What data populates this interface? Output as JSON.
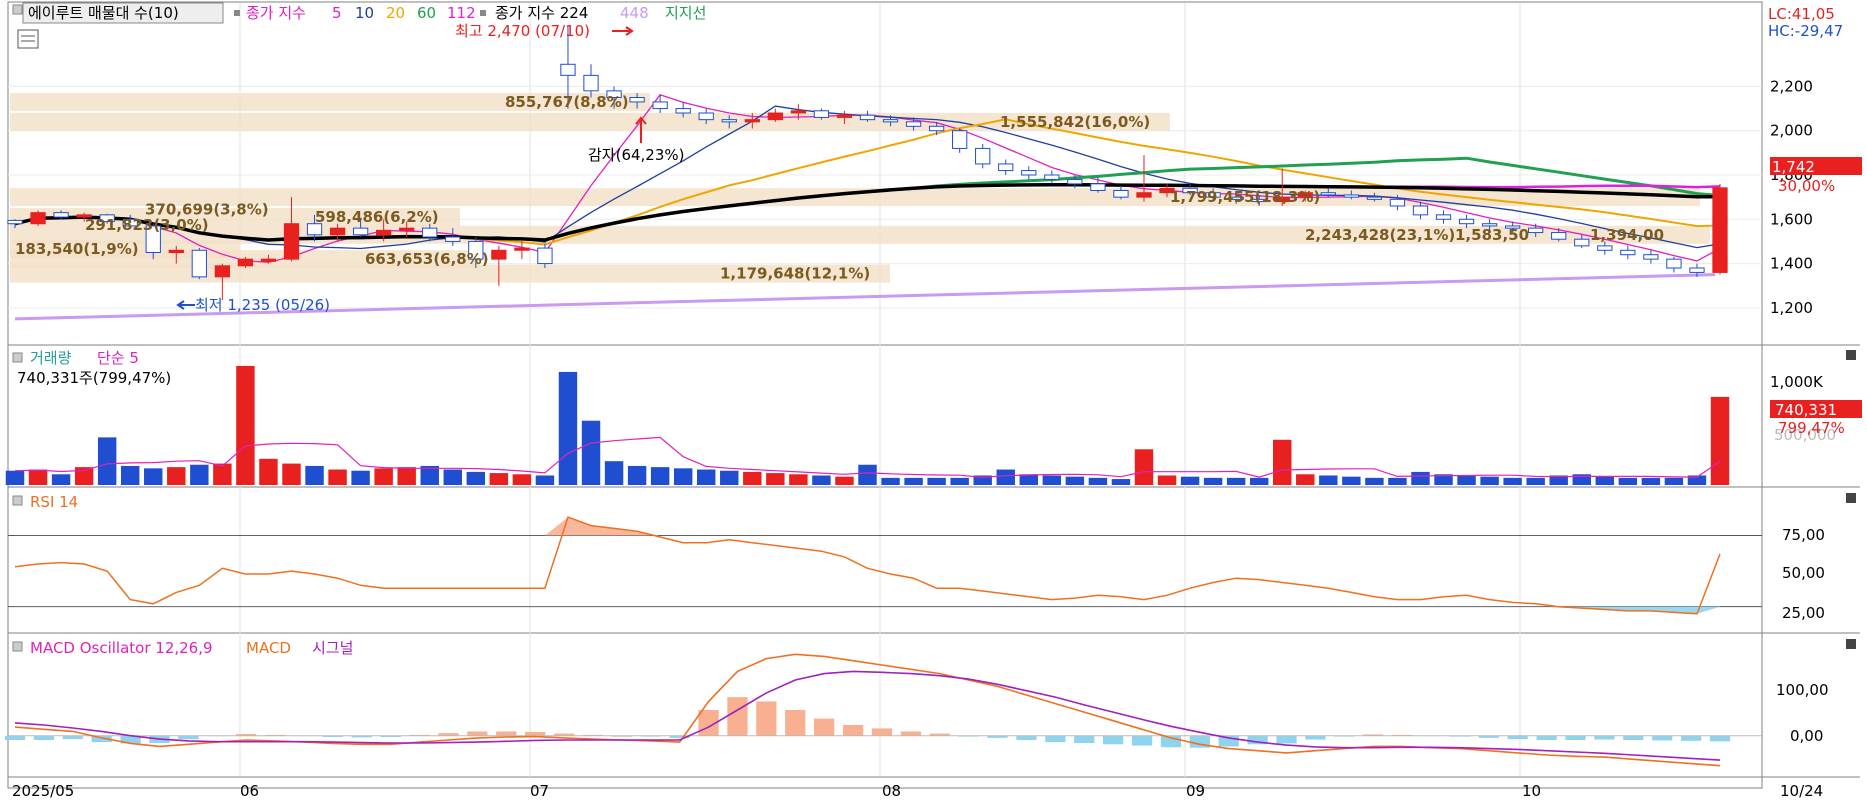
{
  "colors": {
    "up": "#e8201f",
    "down": "#1f4fd0",
    "ma5": "#e020c0",
    "ma10": "#1f3fa0",
    "ma20": "#f0a500",
    "ma60": "#20a050",
    "ma112": "#e020e0",
    "ma224": "#000000",
    "ma448": "#c89af0",
    "vol": "#20a0a0",
    "rsi": "#f07020",
    "macd": "#f07020",
    "signal": "#a020c0",
    "osc_pos": "#f8b090",
    "osc_neg": "#8fd4ef",
    "band": "#f3e0c7"
  },
  "price_panel": {
    "legend": {
      "main": "에이루트 매물대 수(10)",
      "ma_label": "종가 지수",
      "ma5": "5",
      "ma10": "10",
      "ma20": "20",
      "ma60": "60",
      "ma112": "112",
      "ma224_label": "종가 지수 224",
      "ma448": "448",
      "support": "지지선"
    },
    "lc": "LC:41,05",
    "hc": "HC:-29,47",
    "y_ticks": [
      "2,200",
      "2,000",
      "1,800",
      "1,600",
      "1,400",
      "1,200"
    ],
    "last_price": "1,742",
    "last_pct": "30,00%",
    "high_note": "최고 2,470 (07/10)",
    "low_note": "최저 1,235 (05/26)",
    "reduction_note": "감자(64,23%)",
    "bands": [
      "183,540(1,9%)",
      "291,823(3,0%)",
      "370,699(3,8%)",
      "598,486(6,2%)",
      "663,653(6,8%)",
      "1,179,648(12,1%)",
      "2,243,428(23,1%)",
      "1,583,50",
      "1,799,455(18,3%)",
      "855,767(8,8%)",
      "1,555,842(16,0%)",
      "1,394,00"
    ]
  },
  "volume_panel": {
    "title": "거래량",
    "ma_label": "단순 5",
    "summary": "740,331주(799,47%)",
    "y_tick": "1,000K",
    "y_tick2": "500,000",
    "last": "740,331",
    "last_pct": "799,47%"
  },
  "rsi_panel": {
    "title": "RSI 14",
    "y_ticks": [
      "75,00",
      "50,00",
      "25,00"
    ]
  },
  "macd_panel": {
    "title": "MACD Oscillator 12,26,9",
    "macd_label": "MACD",
    "signal_label": "시그널",
    "y_ticks": [
      "100,00",
      "0,00"
    ]
  },
  "x_axis": {
    "labels": [
      "2025/05",
      "06",
      "07",
      "08",
      "09",
      "10"
    ],
    "last": "10/24"
  },
  "chart_data": {
    "type": "line",
    "title": "에이루트 매물대 수(10)",
    "price_ylim": [
      1100,
      2500
    ],
    "candles": [
      [
        1595,
        1600,
        1560,
        1580
      ],
      [
        1580,
        1640,
        1570,
        1630
      ],
      [
        1630,
        1640,
        1600,
        1610
      ],
      [
        1610,
        1630,
        1590,
        1620
      ],
      [
        1620,
        1625,
        1580,
        1590
      ],
      [
        1600,
        1620,
        1560,
        1570
      ],
      [
        1570,
        1580,
        1420,
        1450
      ],
      [
        1450,
        1480,
        1400,
        1460
      ],
      [
        1460,
        1470,
        1330,
        1340
      ],
      [
        1340,
        1400,
        1235,
        1390
      ],
      [
        1390,
        1430,
        1380,
        1420
      ],
      [
        1410,
        1440,
        1400,
        1420
      ],
      [
        1420,
        1700,
        1410,
        1580
      ],
      [
        1580,
        1620,
        1500,
        1530
      ],
      [
        1530,
        1580,
        1500,
        1560
      ],
      [
        1560,
        1600,
        1520,
        1530
      ],
      [
        1530,
        1600,
        1500,
        1550
      ],
      [
        1550,
        1590,
        1520,
        1560
      ],
      [
        1560,
        1580,
        1500,
        1520
      ],
      [
        1520,
        1560,
        1480,
        1500
      ],
      [
        1500,
        1520,
        1380,
        1420
      ],
      [
        1420,
        1480,
        1300,
        1460
      ],
      [
        1460,
        1500,
        1420,
        1470
      ],
      [
        1470,
        1490,
        1380,
        1400
      ],
      [
        2300,
        2470,
        2100,
        2250
      ],
      [
        2250,
        2300,
        2150,
        2180
      ],
      [
        2180,
        2200,
        2100,
        2150
      ],
      [
        2150,
        2170,
        2100,
        2130
      ],
      [
        2130,
        2160,
        2080,
        2100
      ],
      [
        2100,
        2130,
        2060,
        2080
      ],
      [
        2080,
        2100,
        2030,
        2050
      ],
      [
        2050,
        2070,
        2010,
        2040
      ],
      [
        2040,
        2080,
        2010,
        2050
      ],
      [
        2050,
        2100,
        2040,
        2080
      ],
      [
        2080,
        2120,
        2050,
        2090
      ],
      [
        2090,
        2100,
        2050,
        2060
      ],
      [
        2060,
        2090,
        2030,
        2070
      ],
      [
        2070,
        2090,
        2040,
        2050
      ],
      [
        2050,
        2070,
        2020,
        2040
      ],
      [
        2040,
        2060,
        2000,
        2020
      ],
      [
        2020,
        2040,
        1980,
        2000
      ],
      [
        2000,
        2010,
        1900,
        1920
      ],
      [
        1920,
        1940,
        1830,
        1850
      ],
      [
        1850,
        1870,
        1800,
        1820
      ],
      [
        1820,
        1840,
        1780,
        1800
      ],
      [
        1800,
        1820,
        1760,
        1780
      ],
      [
        1780,
        1800,
        1740,
        1760
      ],
      [
        1760,
        1790,
        1720,
        1730
      ],
      [
        1730,
        1750,
        1690,
        1700
      ],
      [
        1700,
        1890,
        1680,
        1720
      ],
      [
        1720,
        1760,
        1700,
        1740
      ],
      [
        1740,
        1760,
        1710,
        1720
      ],
      [
        1720,
        1740,
        1690,
        1700
      ],
      [
        1700,
        1720,
        1670,
        1690
      ],
      [
        1690,
        1710,
        1660,
        1680
      ],
      [
        1680,
        1830,
        1660,
        1700
      ],
      [
        1700,
        1730,
        1680,
        1720
      ],
      [
        1720,
        1740,
        1700,
        1710
      ],
      [
        1710,
        1730,
        1690,
        1700
      ],
      [
        1700,
        1720,
        1680,
        1690
      ],
      [
        1690,
        1710,
        1640,
        1660
      ],
      [
        1660,
        1680,
        1600,
        1620
      ],
      [
        1620,
        1640,
        1580,
        1600
      ],
      [
        1600,
        1620,
        1560,
        1580
      ],
      [
        1580,
        1600,
        1550,
        1570
      ],
      [
        1570,
        1590,
        1540,
        1560
      ],
      [
        1560,
        1580,
        1520,
        1540
      ],
      [
        1540,
        1560,
        1500,
        1510
      ],
      [
        1510,
        1530,
        1470,
        1480
      ],
      [
        1480,
        1500,
        1440,
        1460
      ],
      [
        1460,
        1480,
        1420,
        1440
      ],
      [
        1440,
        1460,
        1400,
        1420
      ],
      [
        1420,
        1430,
        1360,
        1380
      ],
      [
        1380,
        1400,
        1340,
        1360
      ],
      [
        1360,
        1760,
        1350,
        1742
      ]
    ],
    "price_x_range": [
      0,
      74
    ],
    "volume": [
      120,
      130,
      90,
      150,
      400,
      160,
      140,
      150,
      170,
      180,
      1000,
      220,
      180,
      160,
      130,
      120,
      140,
      150,
      160,
      130,
      110,
      100,
      90,
      80,
      950,
      540,
      200,
      160,
      150,
      140,
      130,
      120,
      110,
      100,
      90,
      80,
      70,
      170,
      60,
      60,
      60,
      60,
      80,
      130,
      90,
      80,
      70,
      60,
      50,
      300,
      80,
      70,
      60,
      60,
      60,
      380,
      90,
      80,
      70,
      60,
      60,
      110,
      90,
      80,
      70,
      60,
      60,
      80,
      90,
      70,
      60,
      60,
      60,
      80,
      740
    ],
    "rsi": [
      53,
      55,
      56,
      55,
      50,
      30,
      27,
      35,
      40,
      52,
      48,
      48,
      50,
      48,
      45,
      40,
      38,
      38,
      38,
      38,
      38,
      38,
      38,
      38,
      88,
      82,
      80,
      78,
      74,
      70,
      70,
      72,
      70,
      68,
      66,
      64,
      60,
      52,
      48,
      45,
      38,
      38,
      36,
      34,
      32,
      30,
      31,
      33,
      32,
      30,
      33,
      38,
      42,
      45,
      44,
      42,
      40,
      38,
      35,
      32,
      30,
      30,
      32,
      33,
      30,
      28,
      27,
      25,
      24,
      23,
      22,
      22,
      21,
      20,
      62
    ],
    "macd": [
      20,
      15,
      10,
      -5,
      -18,
      -25,
      -20,
      -15,
      -10,
      -12,
      -15,
      -18,
      -20,
      -20,
      -15,
      -10,
      -5,
      -3,
      -2,
      -5,
      -8,
      -10,
      -12,
      -15,
      80,
      150,
      180,
      190,
      185,
      175,
      165,
      155,
      145,
      130,
      115,
      95,
      75,
      55,
      35,
      15,
      -5,
      -20,
      -30,
      -35,
      -40,
      -35,
      -30,
      -25,
      -25,
      -28,
      -30,
      -35,
      -40,
      -45,
      -48,
      -50,
      -55,
      -60,
      -65,
      -70
    ],
    "signal": [
      30,
      25,
      18,
      10,
      0,
      -8,
      -12,
      -14,
      -14,
      -14,
      -14,
      -15,
      -16,
      -17,
      -17,
      -16,
      -15,
      -13,
      -11,
      -10,
      -10,
      -10,
      -10,
      -10,
      20,
      60,
      100,
      130,
      145,
      150,
      148,
      145,
      140,
      132,
      120,
      105,
      90,
      72,
      55,
      38,
      22,
      8,
      -5,
      -15,
      -22,
      -26,
      -28,
      -28,
      -27,
      -27,
      -28,
      -30,
      -32,
      -35,
      -38,
      -41,
      -45,
      -49,
      -53,
      -57
    ],
    "macd_ylim": [
      -80,
      200
    ]
  }
}
